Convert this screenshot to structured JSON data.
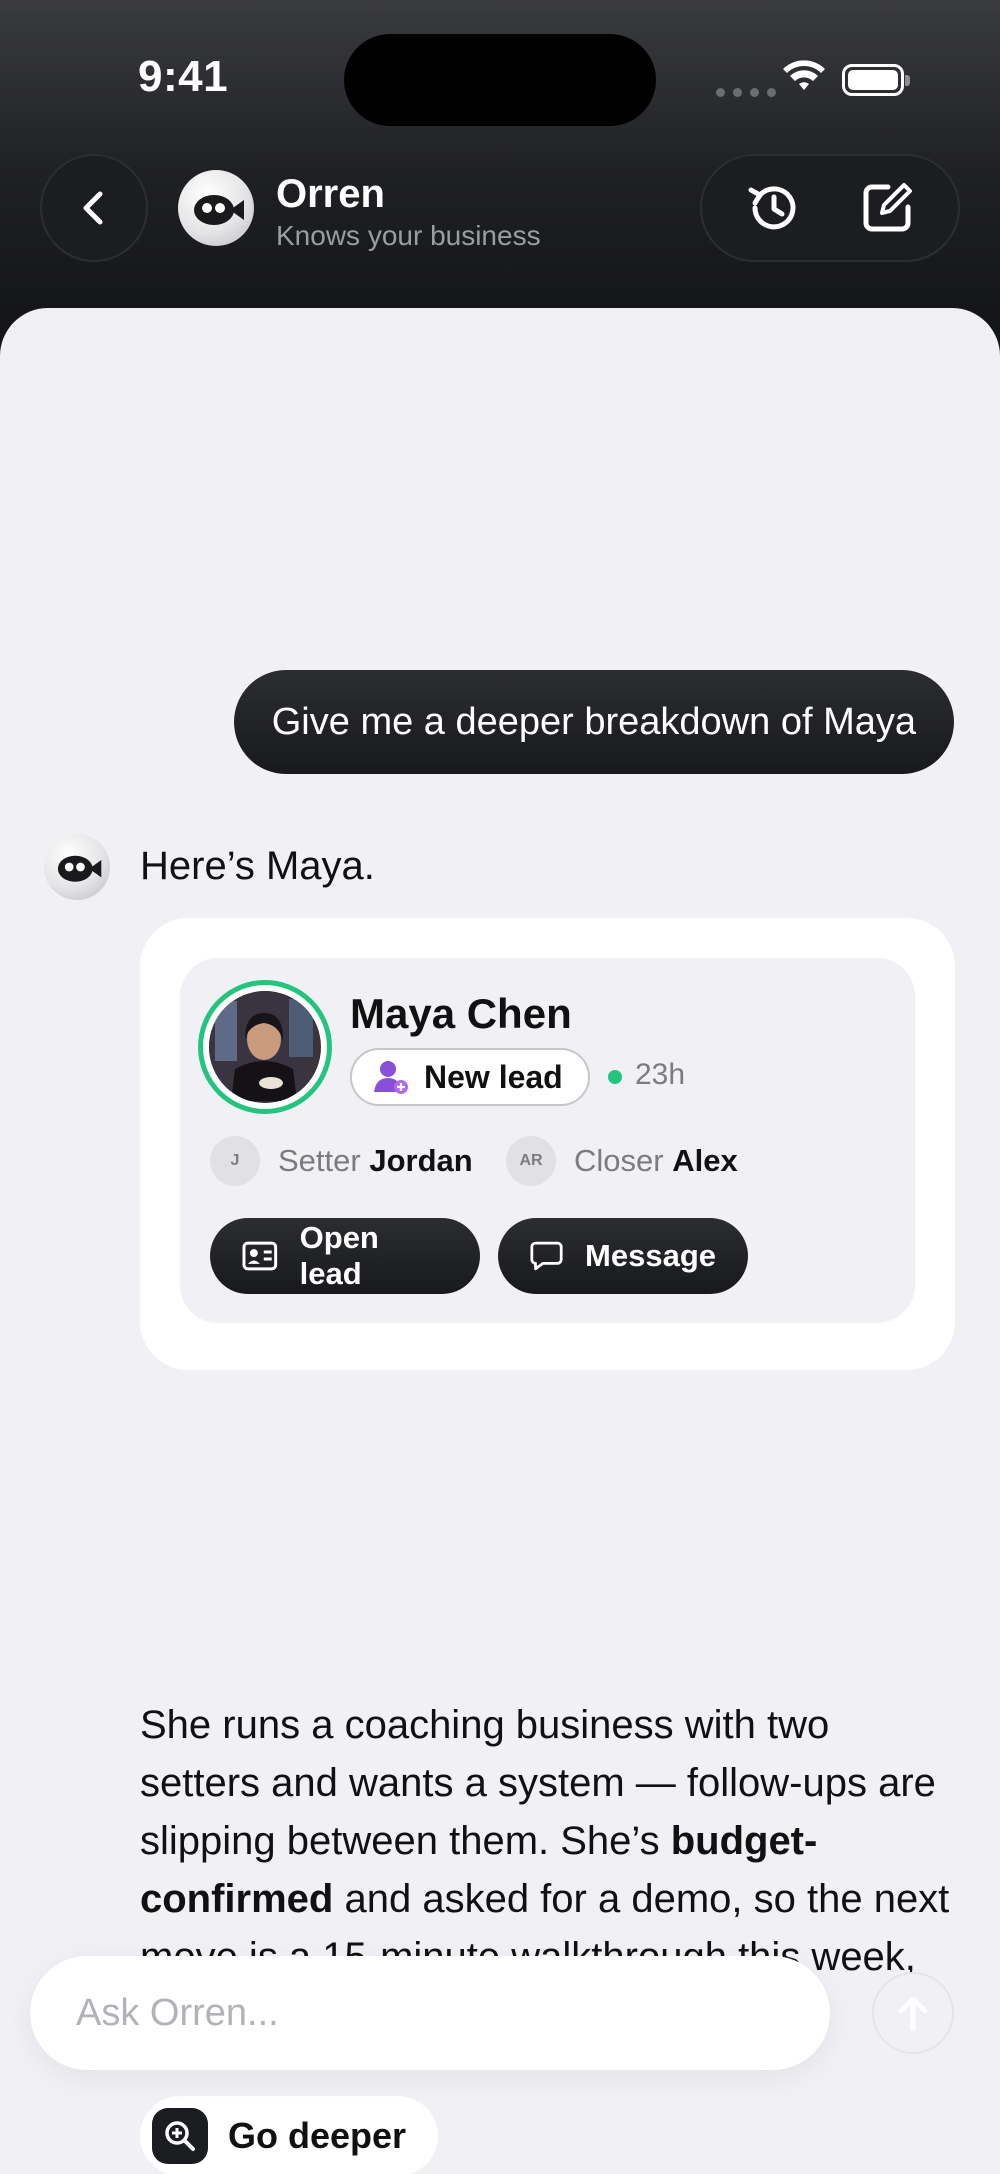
{
  "status_bar": {
    "time": "9:41"
  },
  "header": {
    "title": "Orren",
    "subtitle": "Knows your business",
    "back_icon": "chevron-left-icon",
    "history_icon": "history-icon",
    "compose_icon": "compose-icon"
  },
  "conversation": {
    "user_message": "Give me a deeper breakdown of Maya",
    "reply_intro": "Here’s Maya.",
    "reply_body": {
      "part1": "She runs a coaching business with two setters and wants a system — follow-ups are slipping between them. She’s ",
      "bold": "budget-confirmed",
      "part2": " and asked for a demo, so the next move is a 15-minute walkthrough this week, before the window closes."
    },
    "go_deeper_label": "Go deeper"
  },
  "lead_card": {
    "name": "Maya Chen",
    "status": "New lead",
    "last_active": "23h",
    "setter": {
      "initials": "J",
      "role": "Setter",
      "name": "Jordan"
    },
    "closer": {
      "initials": "AR",
      "role": "Closer",
      "name": "Alex"
    },
    "open_lead_label": "Open lead",
    "message_label": "Message"
  },
  "composer": {
    "placeholder": "Ask Orren..."
  },
  "colors": {
    "accent_green": "#22c47e",
    "dark_button": "#1c1d20",
    "sheet_bg": "#f0f0f5"
  }
}
